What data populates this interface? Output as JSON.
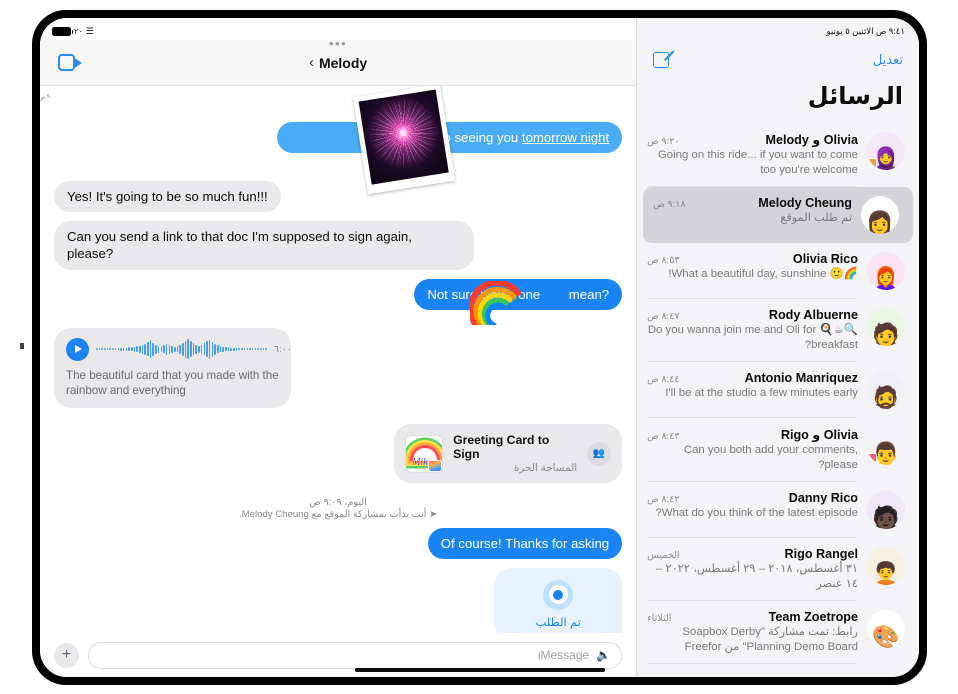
{
  "conversation": {
    "statusbar": {
      "battery_percent": "٢٠",
      "battery_icon": "battery-icon",
      "wifi_icon": "wifi-icon"
    },
    "navbar": {
      "facetime_icon": "facetime-video-icon",
      "back_chevron": "‹",
      "title": "Melody",
      "grabber_dots": "•••"
    },
    "messages": [
      {
        "id": "photo-sticker",
        "kind": "photo-sticker",
        "icon": "fireworks-photo",
        "time": "٩ ص"
      },
      {
        "id": "msg-1",
        "kind": "outgoing",
        "text_before": "ard to seeing you ",
        "text_link": "tomorrow night"
      },
      {
        "id": "msg-2",
        "kind": "incoming",
        "text": "Yes! It's going to be so much fun!!!"
      },
      {
        "id": "msg-3",
        "kind": "incoming",
        "text": "Can you send a link to that doc I'm supposed to sign again, please?"
      },
      {
        "id": "msg-4",
        "kind": "outgoing",
        "text_before": "Not sure which one ",
        "text_after": " mean?",
        "sticker": "rainbow-sticker"
      },
      {
        "id": "msg-5",
        "kind": "audio",
        "duration": "٦:٠٠",
        "transcript": "The beautiful card that you made with the rainbow and everything",
        "play_icon": "play-icon"
      },
      {
        "id": "msg-6",
        "kind": "link-card",
        "title": "Greeting Card to Sign",
        "subtitle": "المساحة الحرة",
        "thumb_scribble": "Mike",
        "people_icon": "people-icon"
      },
      {
        "id": "system-1",
        "kind": "system",
        "line1": "اليوم، ٩:٠٩ ص",
        "line2": "أنت بدأت بمشاركة الموقع مع Melody Cheung.",
        "arrow_icon": "location-arrow-icon"
      },
      {
        "id": "msg-7",
        "kind": "outgoing",
        "text": "Of course! Thanks for asking"
      },
      {
        "id": "msg-8",
        "kind": "location-request",
        "label": "تم الطلب",
        "icon": "location-target-icon"
      }
    ],
    "composer": {
      "plus_icon": "plus-icon",
      "placeholder": "iMessage",
      "mic_icon": "microphone-icon"
    }
  },
  "list": {
    "statusbar_text": "٩:٤١ ص  الاثنين ٥ يونيو",
    "edit_label": "تعديل",
    "compose_icon": "compose-new-message-icon",
    "heading": "الرسائل",
    "threads": [
      {
        "name": "Olivia و Melody",
        "time": "٩:٢٠ ص",
        "preview": "Going on this ride... if you want to come too you're welcome",
        "avatar_emoji": "🧕",
        "avatar_bg": "#f3e7f8",
        "badge": "lock",
        "selected": false
      },
      {
        "name": "Melody Cheung",
        "time": "٩:١٨ ص",
        "preview": "تم طلب الموقع",
        "avatar_emoji": "👩",
        "avatar_bg": "#ffffff",
        "badge": "",
        "selected": true
      },
      {
        "name": "Olivia Rico",
        "time": "٨:٥٣ ص",
        "preview": "🌈🙂 What a beautiful day, sunshine!",
        "avatar_emoji": "👩‍🦰",
        "avatar_bg": "#fbe4ef",
        "badge": "",
        "selected": false
      },
      {
        "name": "Rody Albuerne",
        "time": "٨:٤٧ ص",
        "preview": "Do you wanna join me and Oli for 🍳☕🔍 breakfast?",
        "avatar_emoji": "🧑",
        "avatar_bg": "#e9f6e4",
        "badge": "",
        "selected": false
      },
      {
        "name": "Antonio Manriquez",
        "time": "٨:٤٤ ص",
        "preview": "I'll be at the studio a few minutes early",
        "avatar_emoji": "🧔",
        "avatar_bg": "#f0f0f2",
        "badge": "",
        "selected": false
      },
      {
        "name": "Olivia و Rigo",
        "time": "٨:٤٣ ص",
        "preview": "Can you both add your comments, please?",
        "avatar_emoji": "👨",
        "avatar_bg": "#f4f4f6",
        "badge": "pink",
        "selected": false
      },
      {
        "name": "Danny Rico",
        "time": "٨:٤٢ ص",
        "preview": "What do you think of the latest episode?",
        "avatar_emoji": "🧑🏿",
        "avatar_bg": "#eee8f8",
        "badge": "",
        "selected": false
      },
      {
        "name": "Rigo Rangel",
        "time": "الخميس",
        "preview": "٣١ أغسطس، ٢٠١٨ – ٢٩ أغسطس، ٢٠٢٢ – ١٤ عنصر",
        "avatar_emoji": "🧑‍🦱",
        "avatar_bg": "#f6f0e4",
        "badge": "",
        "selected": false
      },
      {
        "name": "Team Zoetrope",
        "time": "الثلاثاء",
        "preview": "رابط: تمت مشاركة \"Soapbox Derby Planning Demo Board\" من Freefor",
        "avatar_emoji": "🎨",
        "avatar_bg": "#ffffff",
        "badge": "",
        "selected": false
      }
    ]
  },
  "colors": {
    "accent_blue": "#2b8cf5",
    "bubble_outgoing": "#4aabf7",
    "bubble_outgoing_deep": "#1a84f5",
    "bubble_incoming": "#e9e9eb",
    "list_bg": "#f4f4f6",
    "selected_row": "#d4d4d8"
  }
}
